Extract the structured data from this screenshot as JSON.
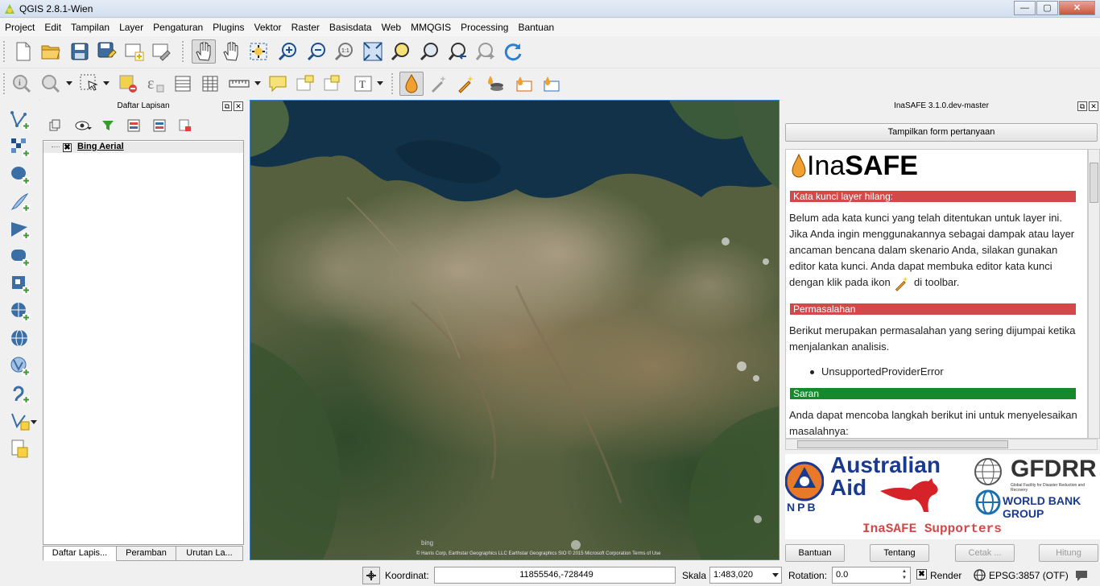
{
  "window": {
    "title": "QGIS 2.8.1-Wien",
    "minimize": "—",
    "maximize": "▢",
    "close": "✕"
  },
  "menu": [
    "Project",
    "Edit",
    "Tampilan",
    "Layer",
    "Pengaturan",
    "Plugins",
    "Vektor",
    "Raster",
    "Basisdata",
    "Web",
    "MMQGIS",
    "Processing",
    "Bantuan"
  ],
  "layers_panel": {
    "title": "Daftar Lapisan",
    "layers": [
      {
        "name": "Bing Aerial",
        "checked": true
      }
    ],
    "tabs": [
      "Daftar Lapis...",
      "Peramban",
      "Urutan La..."
    ]
  },
  "map": {
    "attribution": "© Harris Corp, Earthstar Geographics LLC Earthstar Geographics SIO © 2015 Microsoft Corporation Terms of Use",
    "bing_label": "bing"
  },
  "inasafe": {
    "title": "InaSAFE 3.1.0.dev-master",
    "form_button": "Tampilkan form pertanyaan",
    "logo_light": "Ina",
    "logo_bold": "SAFE",
    "sections": {
      "missing_keywords_title": "Kata kunci layer hilang:",
      "missing_keywords_text_1": "Belum ada kata kunci yang telah ditentukan untuk layer ini. Jika Anda ingin menggunakannya sebagai dampak atau layer ancaman bencana dalam skenario Anda, silakan gunakan editor kata kunci. Anda dapat membuka editor kata kunci dengan klik pada ikon",
      "missing_keywords_text_2": "di toolbar.",
      "problem_title": "Permasalahan",
      "problem_text": "Berikut merupakan permasalahan yang sering dijumpai ketika menjalankan analisis.",
      "problem_item": "UnsupportedProviderError",
      "suggestion_title": "Saran",
      "suggestion_text": "Anda dapat mencoba langkah berikut ini untuk menyelesaikan masalahnya:"
    },
    "supporters": {
      "npb": "NPB",
      "aus_line1": "Australian",
      "aus_line2": "Aid",
      "gfdrr": "GFDRR",
      "gfdrr_sub": "Global Facility for Disaster Reduction and Recovery",
      "worldbank": "WORLD BANK GROUP",
      "title": "InaSAFE Supporters"
    },
    "buttons": {
      "help": "Bantuan",
      "about": "Tentang",
      "print": "Cetak ...",
      "run": "Hitung"
    }
  },
  "statusbar": {
    "coord_label": "Koordinat:",
    "coord_value": "11855546,-728449",
    "scale_label": "Skala",
    "scale_value": "1:483,020",
    "rotation_label": "Rotation:",
    "rotation_value": "0.0",
    "render_label": "Render",
    "crs": "EPSG:3857 (OTF)"
  }
}
